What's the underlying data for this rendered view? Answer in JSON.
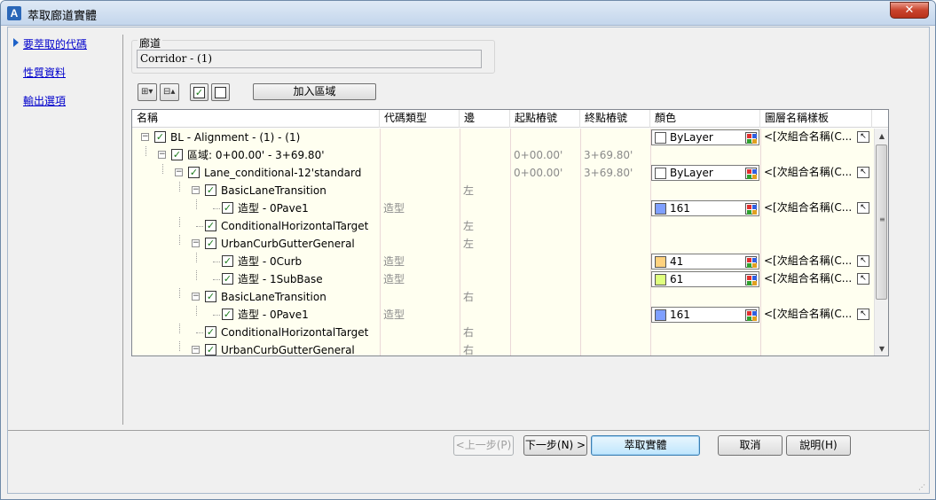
{
  "window": {
    "title": "萃取廊道實體",
    "close_glyph": "✕",
    "app_icon_letter": "A"
  },
  "nav": {
    "items": [
      {
        "label": "要萃取的代碼",
        "active": true
      },
      {
        "label": "性質資料",
        "active": false
      },
      {
        "label": "輸出選項",
        "active": false
      }
    ]
  },
  "corridor": {
    "label": "廊道",
    "value": "Corridor - (1)"
  },
  "toolbar": {
    "expand_glyph": "⊞▾",
    "collapse_glyph": "⊟▴",
    "check_all_glyph": "✓",
    "uncheck_all_glyph": "",
    "add_region_label": "加入區域"
  },
  "columns": [
    "名稱",
    "代碼類型",
    "邊",
    "起點樁號",
    "終點樁號",
    "顏色",
    "圖層名稱樣板"
  ],
  "rows": [
    {
      "name": "BL - Alignment - (1) - (1)",
      "type": "",
      "side": "",
      "start": "",
      "end": "",
      "color_label": "ByLayer",
      "layer": "<[次組合名稱(C..."
    },
    {
      "name": "區域: 0+00.00' - 3+69.80'",
      "type": "",
      "side": "",
      "start": "0+00.00'",
      "end": "3+69.80'",
      "color_label": "",
      "layer": ""
    },
    {
      "name": "Lane_conditional-12'standard",
      "type": "",
      "side": "",
      "start": "0+00.00'",
      "end": "3+69.80'",
      "color_label": "ByLayer",
      "layer": "<[次組合名稱(C..."
    },
    {
      "name": "BasicLaneTransition",
      "type": "",
      "side": "左",
      "start": "",
      "end": "",
      "color_label": "",
      "layer": ""
    },
    {
      "name": "造型 - 0Pave1",
      "type": "造型",
      "side": "",
      "start": "",
      "end": "",
      "color_label": "161",
      "layer": "<[次組合名稱(C..."
    },
    {
      "name": "ConditionalHorizontalTarget",
      "type": "",
      "side": "左",
      "start": "",
      "end": "",
      "color_label": "",
      "layer": ""
    },
    {
      "name": "UrbanCurbGutterGeneral",
      "type": "",
      "side": "左",
      "start": "",
      "end": "",
      "color_label": "",
      "layer": ""
    },
    {
      "name": "造型 - 0Curb",
      "type": "造型",
      "side": "",
      "start": "",
      "end": "",
      "color_label": "41",
      "layer": "<[次組合名稱(C..."
    },
    {
      "name": "造型 - 1SubBase",
      "type": "造型",
      "side": "",
      "start": "",
      "end": "",
      "color_label": "61",
      "layer": "<[次組合名稱(C..."
    },
    {
      "name": "BasicLaneTransition",
      "type": "",
      "side": "右",
      "start": "",
      "end": "",
      "color_label": "",
      "layer": ""
    },
    {
      "name": "造型 - 0Pave1",
      "type": "造型",
      "side": "",
      "start": "",
      "end": "",
      "color_label": "161",
      "layer": "<[次組合名稱(C..."
    },
    {
      "name": "ConditionalHorizontalTarget",
      "type": "",
      "side": "右",
      "start": "",
      "end": "",
      "color_label": "",
      "layer": ""
    },
    {
      "name": "UrbanCurbGutterGeneral",
      "type": "",
      "side": "右",
      "start": "",
      "end": "",
      "color_label": "",
      "layer": ""
    }
  ],
  "swatch_colors": {
    "ByLayer": "#ffffff",
    "161": "#7f9fff",
    "41": "#ffd27f",
    "61": "#dfff7f"
  },
  "footer": {
    "back_label": "<上一步(P)",
    "next_label": "下一步(N) >",
    "extract_label": "萃取實體",
    "cancel_label": "取消",
    "help_label": "說明(H)"
  }
}
